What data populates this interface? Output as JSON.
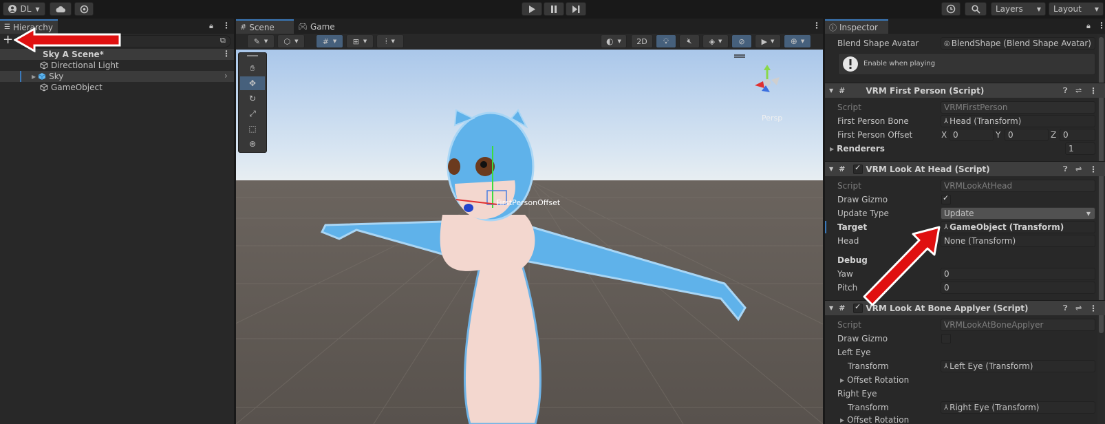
{
  "toolbar": {
    "account_label": "DL",
    "layers_label": "Layers",
    "layout_label": "Layout"
  },
  "hierarchy": {
    "tab_label": "Hierarchy",
    "scene_name": "Sky A Scene*",
    "items": [
      {
        "label": "Directional Light"
      },
      {
        "label": "Sky"
      },
      {
        "label": "GameObject"
      }
    ]
  },
  "scene": {
    "tab_scene": "Scene",
    "tab_game": "Game",
    "btn_2d": "2D",
    "persp_label": "Persp",
    "offset_label": "FirstPersonOffset"
  },
  "inspector": {
    "tab_label": "Inspector",
    "blend_shape_avatar_label": "Blend Shape Avatar",
    "blend_shape_avatar_value": "BlendShape (Blend Shape Avatar)",
    "help_text": "Enable when playing",
    "first_person": {
      "title": "VRM First Person (Script)",
      "script_label": "Script",
      "script_value": "VRMFirstPerson",
      "bone_label": "First Person Bone",
      "bone_value": "Head (Transform)",
      "offset_label": "First Person Offset",
      "x_label": "X",
      "x_value": "0",
      "y_label": "Y",
      "y_value": "0",
      "z_label": "Z",
      "z_value": "0",
      "renderers_label": "Renderers",
      "renderers_value": "1"
    },
    "look_at_head": {
      "title": "VRM Look At Head (Script)",
      "script_label": "Script",
      "script_value": "VRMLookAtHead",
      "draw_gizmo_label": "Draw Gizmo",
      "update_type_label": "Update Type",
      "update_type_value": "Update",
      "target_label": "Target",
      "target_value": "GameObject (Transform)",
      "head_label": "Head",
      "head_value": "None (Transform)",
      "debug_label": "Debug",
      "yaw_label": "Yaw",
      "yaw_value": "0",
      "pitch_label": "Pitch",
      "pitch_value": "0"
    },
    "bone_applyer": {
      "title": "VRM Look At Bone Applyer (Script)",
      "script_label": "Script",
      "script_value": "VRMLookAtBoneApplyer",
      "draw_gizmo_label": "Draw Gizmo",
      "left_eye_label": "Left Eye",
      "left_transform_label": "Transform",
      "left_transform_value": "Left Eye (Transform)",
      "left_offset_label": "Offset Rotation",
      "right_eye_label": "Right Eye",
      "right_transform_label": "Transform",
      "right_transform_value": "Right Eye (Transform)",
      "right_offset_label": "Offset Rotation"
    }
  },
  "colors": {
    "accent": "#3a79bb",
    "arrow": "#e01010",
    "panel": "#282828"
  }
}
